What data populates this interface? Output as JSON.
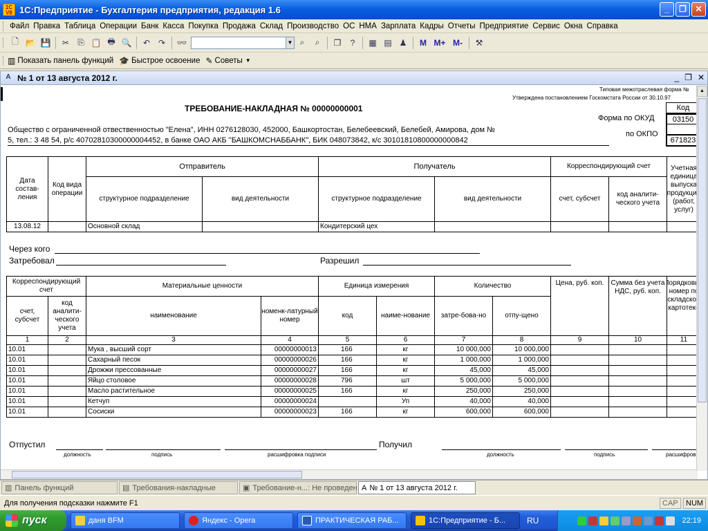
{
  "window": {
    "title": "1С:Предприятие - Бухгалтерия предприятия, редакция 1.6",
    "logo": "1С V8"
  },
  "menu": [
    "Файл",
    "Правка",
    "Таблица",
    "Операции",
    "Банк",
    "Касса",
    "Покупка",
    "Продажа",
    "Склад",
    "Производство",
    "ОС",
    "НМА",
    "Зарплата",
    "Кадры",
    "Отчеты",
    "Предприятие",
    "Сервис",
    "Окна",
    "Справка"
  ],
  "toolbar2": {
    "show_panel": "Показать панель функций",
    "quick_start": "Быстрое освоение",
    "tips": "Советы"
  },
  "docwin": {
    "title": "№ 1 от 13 августа 2012 г."
  },
  "form": {
    "approval_line1": "Типовая межотраслевая форма №",
    "approval_line2": "Утверждена постановлением Госкомстата России от 30.10.97",
    "title": "ТРЕБОВАНИЕ-НАКЛАДНАЯ № 00000000001",
    "code_header": "Код",
    "okud_label": "Форма по ОКУД",
    "okud_value": "03150",
    "okpo_label": "по ОКПО",
    "okpo_value": "671823",
    "org_line1": "Общество с ограниченной отвественностью \"Елена\", ИНН 0276128030, 452000, Башкортостан, Белебеевский, Белебей, Амирова, дом №",
    "org_line2": "5, тел.: 3 48 54, р/с 40702810300000004452, в банке ОАО АКБ \"БАШКОМСНАББАНК\", БИК 048073842, к/с 30101810800000000842"
  },
  "header_table": {
    "date_col": "Дата состав-ления",
    "op_code_col": "Код вида операции",
    "sender": "Отправитель",
    "receiver": "Получатель",
    "corr_account": "Корреспондирующий счет",
    "struct_unit": "структурное подразделение",
    "activity": "вид деятельности",
    "account_sub": "счет, субсчет",
    "analytic_code": "код аналити-ческого учета",
    "output_unit": "Учетная единица выпуска продукции (работ, услуг)",
    "row": {
      "date": "13.08.12",
      "op_code": "",
      "sender_unit": "Основной склад",
      "sender_activity": "",
      "receiver_unit": "Кондитерский цех",
      "receiver_activity": "",
      "account": "",
      "analytic": "",
      "unit": ""
    }
  },
  "through": {
    "through_label": "Через кого",
    "requested_label": "Затребовал",
    "allowed_label": "Разрешил"
  },
  "items_table": {
    "corr_account": "Корреспондирующий счет",
    "account_sub": "счет, субсчет",
    "analytic_code": "код аналити-ческого учета",
    "materials": "Материальные ценности",
    "name": "наименование",
    "item_number": "номенк-латурный номер",
    "unit": "Единица измерения",
    "unit_code": "код",
    "unit_name": "наиме-нование",
    "quantity": "Количество",
    "requested": "затре-бова-но",
    "released": "отпу-щено",
    "price": "Цена, руб. коп.",
    "sum": "Сумма без учета НДС, руб. коп.",
    "card_no": "Порядковый номер по складской картотеке",
    "col_numbers": [
      "1",
      "2",
      "3",
      "4",
      "5",
      "6",
      "7",
      "8",
      "9",
      "10",
      "11"
    ],
    "rows": [
      {
        "account": "10.01",
        "analytic": "",
        "name": "Мука , высший сорт",
        "number": "00000000013",
        "code": "166",
        "unit": "кг",
        "requested": "10 000,000",
        "released": "10 000,000"
      },
      {
        "account": "10.01",
        "analytic": "",
        "name": "Сахарный песок",
        "number": "00000000026",
        "code": "166",
        "unit": "кг",
        "requested": "1 000,000",
        "released": "1 000,000"
      },
      {
        "account": "10.01",
        "analytic": "",
        "name": "Дрожжи прессованные",
        "number": "00000000027",
        "code": "166",
        "unit": "кг",
        "requested": "45,000",
        "released": "45,000"
      },
      {
        "account": "10.01",
        "analytic": "",
        "name": "Яйцо столовое",
        "number": "00000000028",
        "code": "796",
        "unit": "шт",
        "requested": "5 000,000",
        "released": "5 000,000"
      },
      {
        "account": "10.01",
        "analytic": "",
        "name": "Масло растительное",
        "number": "00000000025",
        "code": "166",
        "unit": "кг",
        "requested": "250,000",
        "released": "250,000"
      },
      {
        "account": "10.01",
        "analytic": "",
        "name": "Кетчуп",
        "number": "00000000024",
        "code": "",
        "unit": "Уп",
        "requested": "40,000",
        "released": "40,000"
      },
      {
        "account": "10.01",
        "analytic": "",
        "name": "Сосиски",
        "number": "00000000023",
        "code": "166",
        "unit": "кг",
        "requested": "600,000",
        "released": "600,000"
      }
    ]
  },
  "signatures": {
    "released_label": "Отпустил",
    "received_label": "Получил",
    "position": "должность",
    "signature": "подпись",
    "decoding": "расшифровка подписи",
    "decoding_short": "расшифров"
  },
  "window_tabs": [
    "Панель функций",
    "Требования-накладные",
    "Требование-н...: Не проведен",
    "№ 1 от 13 августа 2012 г."
  ],
  "status": {
    "hint": "Для получения подсказки нажмите F1",
    "cap": "CAP",
    "num": "NUM"
  },
  "taskbar": {
    "start": "пуск",
    "items": [
      "даня BFM",
      "Яндекс - Opera",
      "ПРАКТИЧЕСКАЯ РАБ...",
      "1С:Предприятие - Б..."
    ],
    "lang": "RU",
    "time": "22:19"
  }
}
